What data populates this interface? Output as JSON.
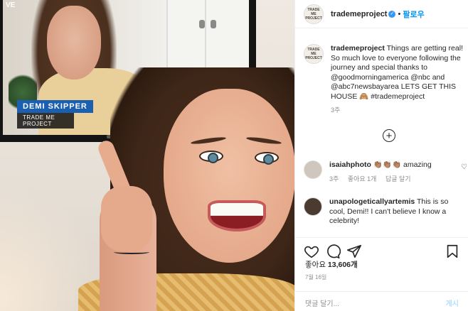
{
  "photo": {
    "tv_live": "VE",
    "tv_name": "DEMI SKIPPER",
    "tv_subtitle": "TRADE ME PROJECT"
  },
  "post": {
    "author": "trademeproject",
    "follow_label": "팔로우",
    "avatar_text": "TRADE ME PROJECT",
    "caption_author": "trademeproject",
    "caption_text": "Things are getting real! So much love to everyone following the journey and special thanks to @goodmorningamerica @nbc and @abc7newsbayarea LETS GET THIS HOUSE 🙈 #trademeproject",
    "caption_time": "3주",
    "load_more_icon": "plus-circle-icon"
  },
  "comments": [
    {
      "user": "isaiahphoto",
      "text": "👏🏽👏🏽👏🏽 amazing",
      "time": "3주",
      "likes": "좋아요 1개",
      "reply": "답글 달기"
    },
    {
      "user": "unapologeticallyartemis",
      "text": "This is so cool, Demi!! I can't believe I know a celebrity!"
    }
  ],
  "actions": {
    "likes_prefix": "좋아요",
    "likes_count": "13,606개",
    "date": "7월 16일"
  },
  "add_comment": {
    "placeholder": "댓글 달기...",
    "post_label": "게시"
  },
  "colors": {
    "accent": "#0095f6",
    "verified": "#3897f0"
  }
}
